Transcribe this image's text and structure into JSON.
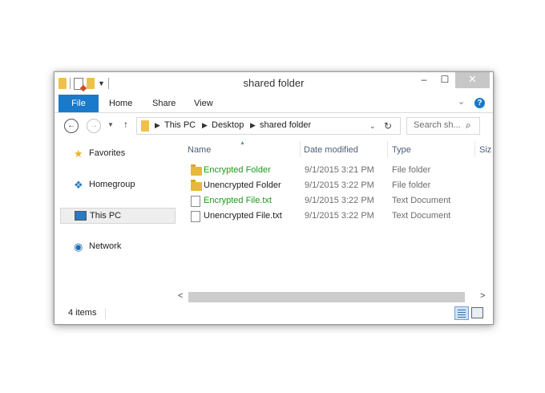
{
  "window": {
    "title": "shared folder"
  },
  "controls": {
    "minimize": "–",
    "maximize": "☐",
    "close": "✕"
  },
  "ribbon": {
    "tabs": [
      "File",
      "Home",
      "Share",
      "View"
    ],
    "help": "?"
  },
  "address": {
    "crumbs": [
      "This PC",
      "Desktop",
      "shared folder"
    ],
    "search_placeholder": "Search sh..."
  },
  "nav_pane": {
    "items": [
      {
        "label": "Favorites",
        "icon": "star-icon"
      },
      {
        "label": "Homegroup",
        "icon": "homegroup-icon"
      },
      {
        "label": "This PC",
        "icon": "this-pc-icon",
        "selected": true
      },
      {
        "label": "Network",
        "icon": "network-icon"
      }
    ]
  },
  "columns": {
    "name": "Name",
    "date": "Date modified",
    "type": "Type",
    "size": "Siz"
  },
  "files": [
    {
      "name": "Encrypted Folder",
      "date": "9/1/2015 3:21 PM",
      "type": "File folder",
      "icon": "folder-icon",
      "color": "#1b9a1b"
    },
    {
      "name": "Unencrypted Folder",
      "date": "9/1/2015 3:22 PM",
      "type": "File folder",
      "icon": "folder-icon",
      "color": "#1e1e1e"
    },
    {
      "name": "Encrypted File.txt",
      "date": "9/1/2015 3:22 PM",
      "type": "Text Document",
      "icon": "text-file-icon",
      "color": "#1b9a1b"
    },
    {
      "name": "Unencrypted File.txt",
      "date": "9/1/2015 3:22 PM",
      "type": "Text Document",
      "icon": "text-file-icon",
      "color": "#1e1e1e"
    }
  ],
  "status": {
    "item_count": "4 items"
  }
}
